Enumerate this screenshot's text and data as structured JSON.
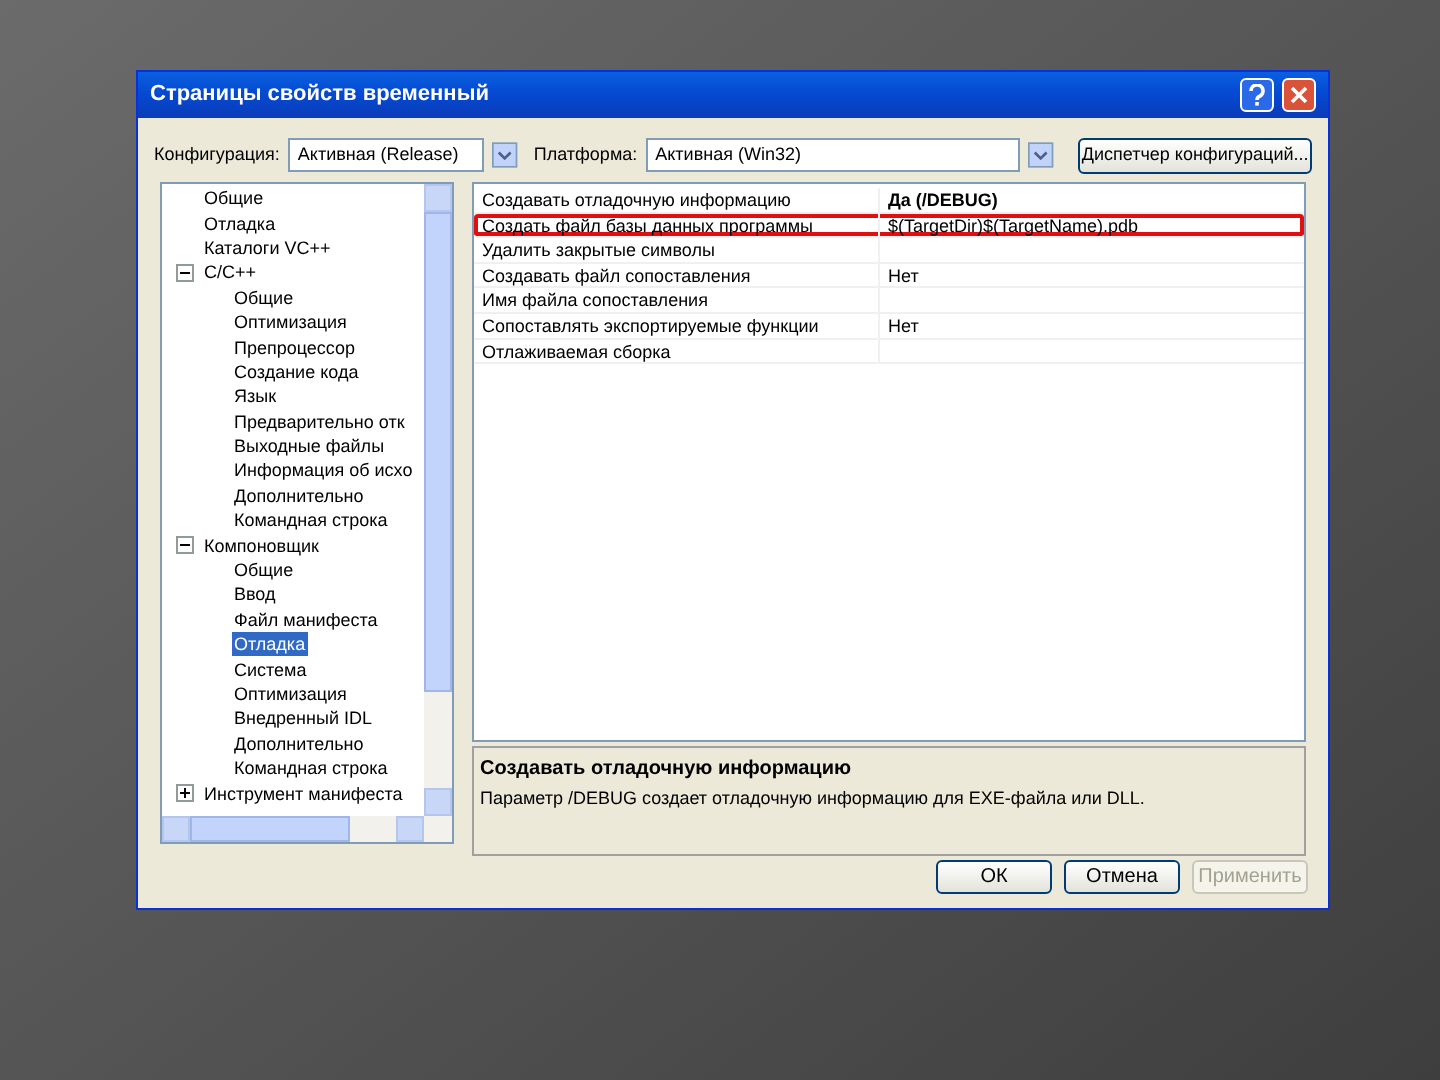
{
  "window": {
    "title": "Страницы свойств временный"
  },
  "toolbar": {
    "configuration_label": "Конфигурация:",
    "configuration_value": "Активная (Release)",
    "platform_label": "Платформа:",
    "platform_value": "Активная (Win32)",
    "manager_button": "Диспетчер конфигураций..."
  },
  "tree": [
    {
      "label": "Общие",
      "selected": false
    },
    {
      "label": "Отладка",
      "selected": false
    },
    {
      "label": "Каталоги VC++",
      "selected": false
    },
    {
      "label": "C/C++",
      "selected": false,
      "expanded": true,
      "children": [
        {
          "label": "Общие",
          "selected": false
        },
        {
          "label": "Оптимизация",
          "selected": false
        },
        {
          "label": "Препроцессор",
          "selected": false
        },
        {
          "label": "Создание кода",
          "selected": false
        },
        {
          "label": "Язык",
          "selected": false
        },
        {
          "label": "Предварительно отк",
          "selected": false
        },
        {
          "label": "Выходные файлы",
          "selected": false
        },
        {
          "label": "Информация об исхо",
          "selected": false
        },
        {
          "label": "Дополнительно",
          "selected": false
        },
        {
          "label": "Командная строка",
          "selected": false
        }
      ]
    },
    {
      "label": "Компоновщик",
      "selected": false,
      "expanded": true,
      "children": [
        {
          "label": "Общие",
          "selected": false
        },
        {
          "label": "Ввод",
          "selected": false
        },
        {
          "label": "Файл манифеста",
          "selected": false
        },
        {
          "label": "Отладка",
          "selected": true
        },
        {
          "label": "Система",
          "selected": false
        },
        {
          "label": "Оптимизация",
          "selected": false
        },
        {
          "label": "Внедренный IDL",
          "selected": false
        },
        {
          "label": "Дополнительно",
          "selected": false
        },
        {
          "label": "Командная строка",
          "selected": false
        }
      ]
    },
    {
      "label": "Инструмент манифеста",
      "selected": false,
      "expanded": false
    }
  ],
  "properties": [
    {
      "name": "Создавать отладочную информацию",
      "value": "Да (/DEBUG)",
      "bold": true,
      "highlighted": false
    },
    {
      "name": "Создать файл базы данных программы",
      "value": "$(TargetDir)$(TargetName).pdb",
      "bold": false,
      "highlighted": true
    },
    {
      "name": "Удалить закрытые символы",
      "highlighted": false
    },
    {
      "name": "Создавать файл сопоставления",
      "value": "Нет",
      "bold": false,
      "highlighted": false
    },
    {
      "name": "Имя файла сопоставления",
      "highlighted": false
    },
    {
      "name": "Сопоставлять экспортируемые функции",
      "value": "Нет",
      "bold": false,
      "highlighted": false
    },
    {
      "name": "Отлаживаемая сборка",
      "highlighted": false
    }
  ],
  "description": {
    "title": "Создавать отладочную информацию",
    "text": "Параметр /DEBUG создает отладочную информацию для EXE-файла или DLL."
  },
  "buttons": [
    {
      "label": "ОК",
      "disabled": false
    },
    {
      "label": "Отмена",
      "disabled": false
    },
    {
      "label": "Применить",
      "disabled": true
    }
  ]
}
